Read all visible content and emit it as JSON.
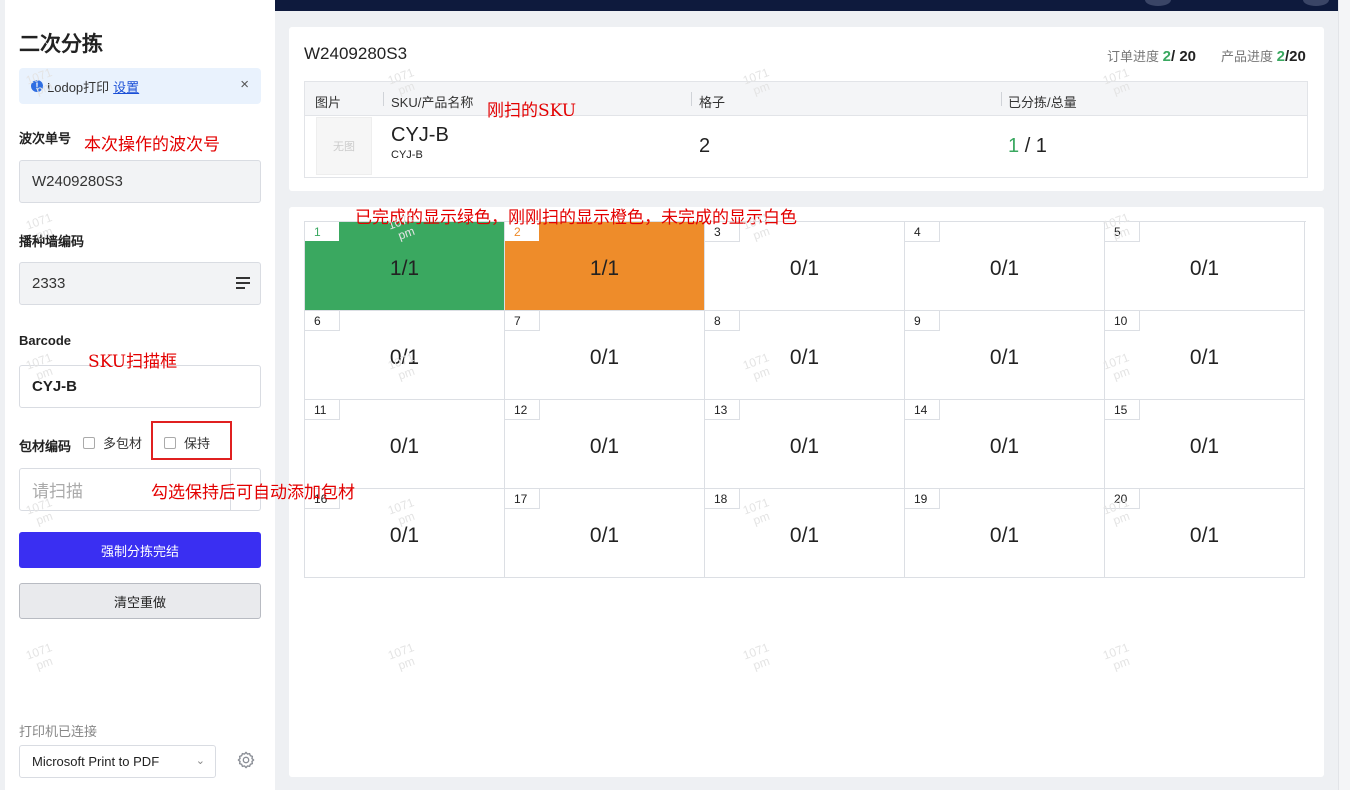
{
  "sidebar": {
    "title": "二次分拣",
    "alert": {
      "text": "Lodop打印",
      "link": "设置"
    },
    "wave": {
      "label": "波次单号",
      "value": "W2409280S3"
    },
    "wall": {
      "label": "播种墙编码",
      "value": "2333"
    },
    "barcode": {
      "label": "Barcode",
      "value": "CYJ-B"
    },
    "packing": {
      "label": "包材编码",
      "multi_label": "多包材",
      "keep_label": "保持",
      "placeholder": "请扫描"
    },
    "force_button": "强制分拣完结",
    "clear_button": "清空重做",
    "printer_status": "打印机已连接",
    "printer_name": "Microsoft Print to PDF"
  },
  "order": {
    "id": "W2409280S3",
    "order_progress_label": "订单进度",
    "order_progress_done": "2",
    "order_progress_total": "/ 20",
    "product_progress_label": "产品进度",
    "product_progress_done": "2",
    "product_progress_total": "/20",
    "columns": [
      "图片",
      "SKU/产品名称",
      "格子",
      "已分拣/总量"
    ],
    "row": {
      "image_placeholder": "无图",
      "sku": "CYJ-B",
      "sku_name": "CYJ-B",
      "slot": "2",
      "sorted": "1",
      "total": "/ 1"
    }
  },
  "slots": [
    {
      "num": "1",
      "count": "1/1",
      "state": "done"
    },
    {
      "num": "2",
      "count": "1/1",
      "state": "current"
    },
    {
      "num": "3",
      "count": "0/1",
      "state": "pending"
    },
    {
      "num": "4",
      "count": "0/1",
      "state": "pending"
    },
    {
      "num": "5",
      "count": "0/1",
      "state": "pending"
    },
    {
      "num": "6",
      "count": "0/1",
      "state": "pending"
    },
    {
      "num": "7",
      "count": "0/1",
      "state": "pending"
    },
    {
      "num": "8",
      "count": "0/1",
      "state": "pending"
    },
    {
      "num": "9",
      "count": "0/1",
      "state": "pending"
    },
    {
      "num": "10",
      "count": "0/1",
      "state": "pending"
    },
    {
      "num": "11",
      "count": "0/1",
      "state": "pending"
    },
    {
      "num": "12",
      "count": "0/1",
      "state": "pending"
    },
    {
      "num": "13",
      "count": "0/1",
      "state": "pending"
    },
    {
      "num": "14",
      "count": "0/1",
      "state": "pending"
    },
    {
      "num": "15",
      "count": "0/1",
      "state": "pending"
    },
    {
      "num": "16",
      "count": "0/1",
      "state": "pending"
    },
    {
      "num": "17",
      "count": "0/1",
      "state": "pending"
    },
    {
      "num": "18",
      "count": "0/1",
      "state": "pending"
    },
    {
      "num": "19",
      "count": "0/1",
      "state": "pending"
    },
    {
      "num": "20",
      "count": "0/1",
      "state": "pending"
    }
  ],
  "annotations": {
    "wave": "本次操作的波次号",
    "sku_just_scanned": "刚扫的SKU",
    "colors": "已完成的显示绿色，刚刚扫的显示橙色，未完成的显示白色",
    "scan_box": "SKU扫描框",
    "keep": "勾选保持后可自动添加包材"
  },
  "watermark": {
    "line1": "1071",
    "line2": "pm"
  },
  "colors": {
    "done": "#3aa860",
    "current": "#ee8c2a",
    "primary": "#3a2ff2",
    "annotation": "#e30000"
  }
}
